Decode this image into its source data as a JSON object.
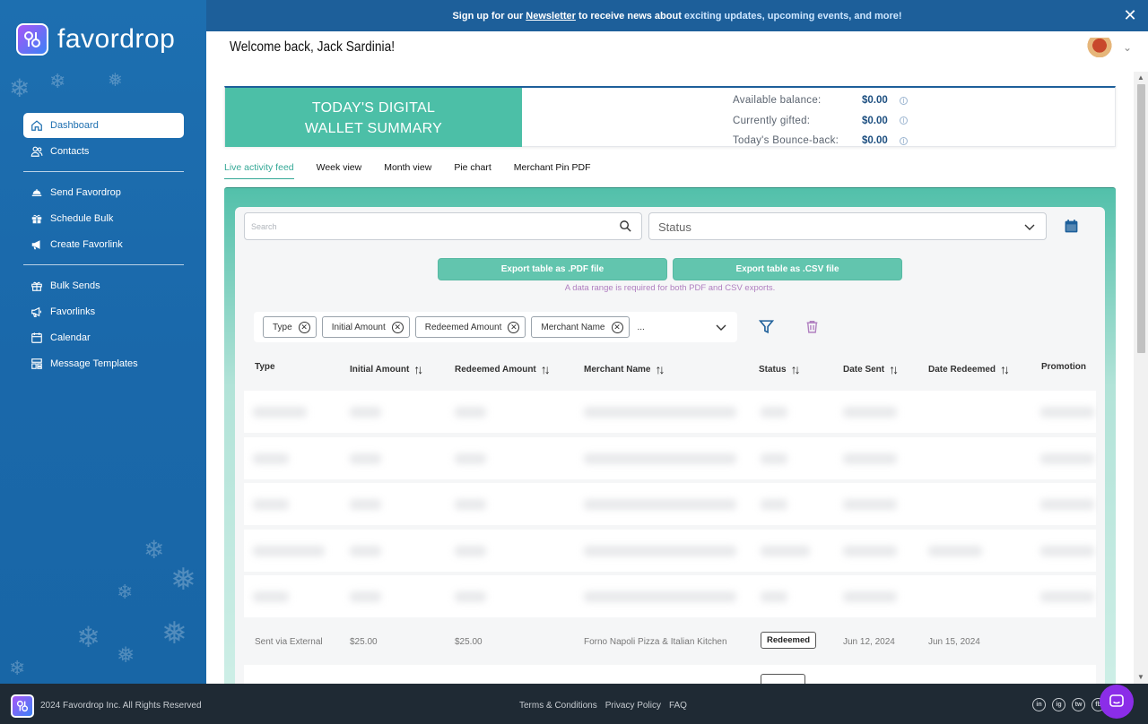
{
  "banner": {
    "prefix": "Sign up for our",
    "link": "Newsletter",
    "middle": "to receive news about",
    "highlight": "exciting updates, upcoming events, and more!"
  },
  "brand": {
    "name_a": "favor",
    "name_b": "drop"
  },
  "sidebar": {
    "items": [
      {
        "label": "Dashboard",
        "icon": "home-icon",
        "active": true
      },
      {
        "label": "Contacts",
        "icon": "contacts-icon"
      },
      {
        "label": "Send Favordrop",
        "icon": "food-tray-icon"
      },
      {
        "label": "Schedule Bulk",
        "icon": "gift-icon"
      },
      {
        "label": "Create Favorlink",
        "icon": "megaphone-icon"
      },
      {
        "label": "Bulk Sends",
        "icon": "gift-box-icon"
      },
      {
        "label": "Favorlinks",
        "icon": "speech-megaphone-icon"
      },
      {
        "label": "Calendar",
        "icon": "calendar-icon"
      },
      {
        "label": "Message Templates",
        "icon": "template-icon"
      }
    ]
  },
  "header": {
    "welcome": "Welcome back, Jack Sardinia!"
  },
  "summary": {
    "title_line1": "TODAY'S DIGITAL",
    "title_line2": "WALLET SUMMARY",
    "rows": [
      {
        "label": "Available balance:",
        "value": "$0.00"
      },
      {
        "label": "Currently gifted:",
        "value": "$0.00"
      },
      {
        "label": "Today's Bounce-back:",
        "value": "$0.00"
      }
    ]
  },
  "tabs": [
    {
      "label": "Live activity feed",
      "active": true
    },
    {
      "label": "Week view"
    },
    {
      "label": "Month view"
    },
    {
      "label": "Pie chart"
    },
    {
      "label": "Merchant Pin PDF"
    }
  ],
  "filters": {
    "search_placeholder": "Search",
    "status_label": "Status",
    "export_pdf": "Export table as .PDF file",
    "export_csv": "Export table as .CSV file",
    "export_note": "A data range is required for both PDF and CSV exports.",
    "chips": [
      "Type",
      "Initial Amount",
      "Redeemed Amount",
      "Merchant Name"
    ],
    "more": "..."
  },
  "table": {
    "headers": [
      "Type",
      "Initial Amount",
      "Redeemed Amount",
      "Merchant Name",
      "Status",
      "Date Sent",
      "Date Redeemed",
      "Promotion"
    ],
    "visible_row": {
      "type": "Sent via External",
      "initial": "$25.00",
      "redeemed": "$25.00",
      "merchant": "Forno Napoli Pizza & Italian Kitchen",
      "status": "Redeemed",
      "date_sent": "Jun 12, 2024",
      "date_redeemed": "Jun 15, 2024"
    }
  },
  "footer": {
    "copyright": "2024 Favordrop Inc. All Rights Reserved",
    "links": [
      "Terms & Conditions",
      "Privacy Policy",
      "FAQ"
    ],
    "social": [
      "in",
      "ig",
      "tw",
      "fb"
    ]
  }
}
